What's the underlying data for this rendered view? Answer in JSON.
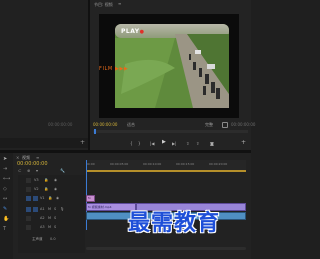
{
  "program_monitor": {
    "tab_label": "节目: 视频",
    "timecode_left": "00:00:00:00",
    "fit_label": "适合",
    "quality_label": "完整",
    "timecode_right": "00:00:00:00"
  },
  "video_overlay": {
    "play_text": "PLAY",
    "film_text": "FILM  ▶▶▶"
  },
  "source_panel": {
    "timecode": "00:00:00:00"
  },
  "timeline": {
    "tab_label": "视频",
    "timecode": "00:00:00:00",
    "ruler_labels": [
      "00:00",
      "00:00:05:00",
      "00:00:10:00",
      "00:00:15:00",
      "00:00:20:00"
    ],
    "tracks": [
      {
        "name": "V3"
      },
      {
        "name": "V2"
      },
      {
        "name": "V1"
      },
      {
        "name": "A1"
      },
      {
        "name": "A2"
      },
      {
        "name": "A3"
      },
      {
        "name": "主声道"
      }
    ],
    "clip_v2_label": "fx",
    "clip_v1_label": "fx  视频素材.mp4",
    "master_value": "0.0"
  },
  "watermark": {
    "text": "最需教育"
  }
}
